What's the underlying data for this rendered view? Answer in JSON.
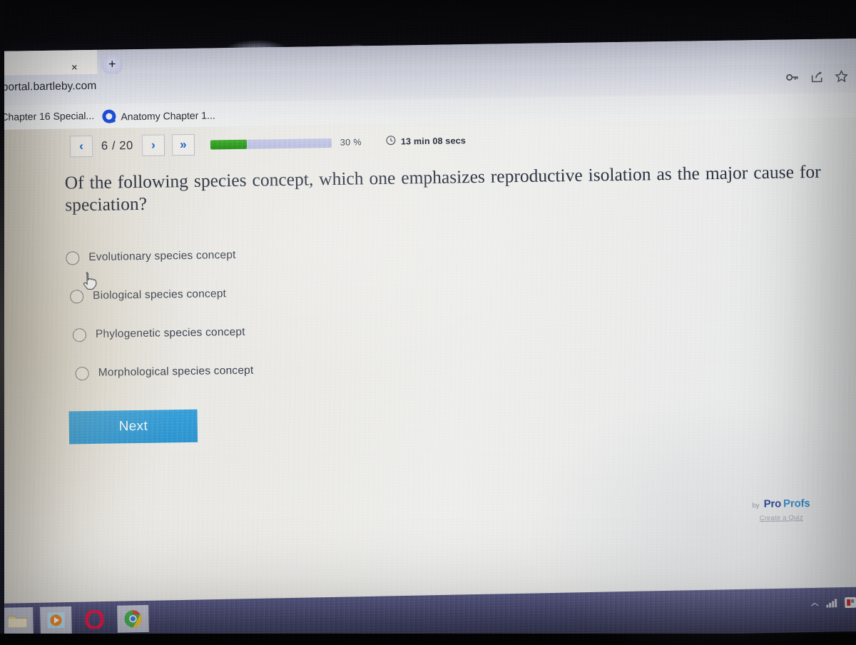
{
  "browser": {
    "url": "portal.bartleby.com",
    "tab_close_label": "×",
    "new_tab_label": "+",
    "toolbar_icons": [
      "key-icon",
      "share-icon",
      "bookmark-star-icon"
    ],
    "bookmarks": [
      {
        "label": "Chapter 16 Special...",
        "icon": "none"
      },
      {
        "label": "Anatomy Chapter 1...",
        "icon": "quizlet-q-icon"
      }
    ]
  },
  "quiz": {
    "nav": {
      "prev_label": "‹",
      "next_label": "›",
      "skip_label": "»",
      "page_indicator": "6 / 20",
      "current_question": 6,
      "total_questions": 20
    },
    "progress": {
      "percent_label": "30 %",
      "percent_value": 30,
      "fill_color": "#2f9a1c",
      "track_color": "#bec3e2"
    },
    "timer": {
      "icon": "clock-icon",
      "text": "13 min 08 secs"
    },
    "question": "Of the following species concept, which one emphasizes reproductive isolation as the major cause for speciation?",
    "options": [
      {
        "label": "Evolutionary species concept",
        "selected": false
      },
      {
        "label": "Biological species concept",
        "selected": false
      },
      {
        "label": "Phylogenetic species concept",
        "selected": false
      },
      {
        "label": "Morphological species concept",
        "selected": false
      }
    ],
    "next_button_label": "Next",
    "next_button_color": "#2f96d0",
    "branding": {
      "by_label": "by",
      "name_part1": "Pro",
      "name_part2": "Profs",
      "name_part1_color": "#1c3f94",
      "name_part2_color": "#2e86c8",
      "link_label": "Create a Quiz"
    }
  },
  "taskbar": {
    "items": [
      {
        "name": "file-explorer-icon"
      },
      {
        "name": "media-player-icon"
      },
      {
        "name": "opera-browser-icon"
      },
      {
        "name": "chrome-browser-icon"
      }
    ],
    "tray": [
      "show-hidden-icons-chevron",
      "network-signal-icon",
      "notification-badge-icon"
    ],
    "background_color": "#4c4d74"
  }
}
